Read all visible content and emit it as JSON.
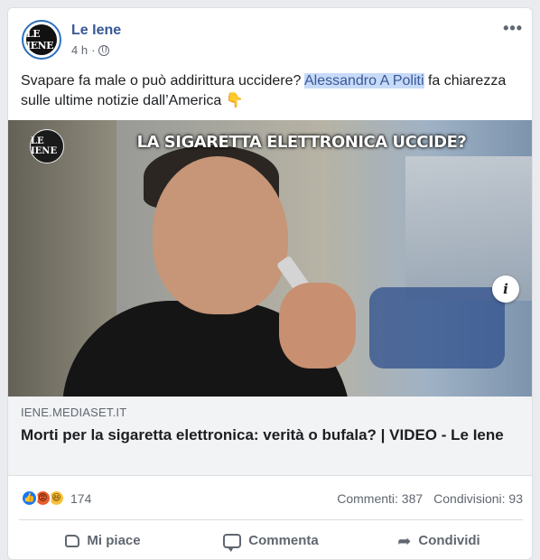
{
  "post": {
    "page_name": "Le Iene",
    "time": "4 h",
    "separator": "·",
    "avatar_text": "LE IENE",
    "more_label": "•••",
    "text_before": "Svapare fa male o può addirittura uccidere? ",
    "mention": "Alessandro A Politi",
    "text_after": " fa chiarezza sulle ultime notizie dall’America ",
    "emoji": "👇",
    "privacy_icon": "globe-icon"
  },
  "media": {
    "logo_text": "LE IENE",
    "caption": "LA SIGARETTA ELETTRONICA UCCIDE?",
    "info_label": "i"
  },
  "link": {
    "domain": "IENE.MEDIASET.IT",
    "title": "Morti per la sigaretta elettronica: verità o bufala? | VIDEO - Le Iene"
  },
  "stats": {
    "reaction_icons": [
      "like-icon",
      "angry-icon",
      "haha-icon"
    ],
    "reaction_count": "174",
    "comments": "Commenti: 387",
    "shares": "Condivisioni: 93"
  },
  "actions": {
    "like": "Mi piace",
    "comment": "Commenta",
    "share": "Condividi"
  },
  "colors": {
    "link_blue": "#385898",
    "mention_highlight": "#c7daf7",
    "like_blue": "#1877f2"
  }
}
